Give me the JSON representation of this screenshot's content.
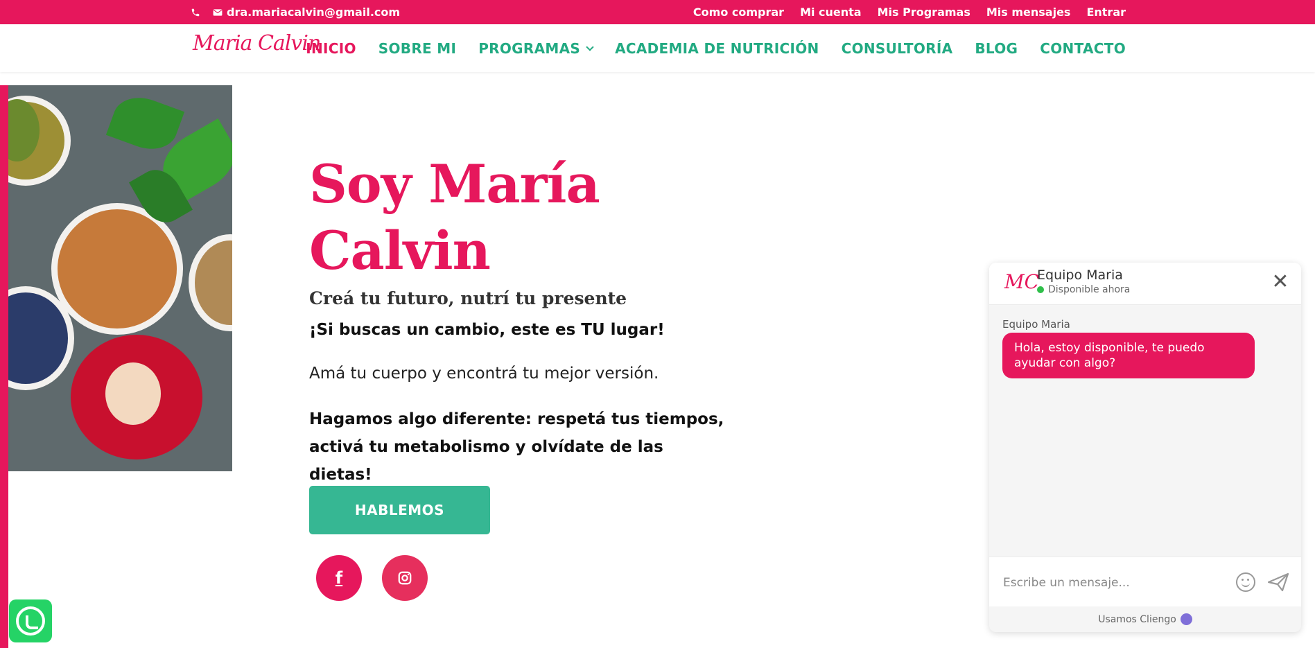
{
  "topbar": {
    "phone_icon": "phone-icon",
    "email": "dra.mariacalvin@gmail.com",
    "links": [
      "Como comprar",
      "Mi cuenta",
      "Mis Programas",
      "Mis mensajes",
      "Entrar"
    ]
  },
  "header": {
    "logo": "Maria Calvin",
    "nav": [
      "INICIO",
      "SOBRE MI",
      "PROGRAMAS",
      "ACADEMIA DE NUTRICIÓN",
      "CONSULTORÍA",
      "BLOG",
      "CONTACTO"
    ]
  },
  "hero": {
    "title_line1": "Soy María",
    "title_line2": "Calvin",
    "subtitle": "Creá tu futuro, nutrí tu presente",
    "line1": "¡Si buscas un cambio, este es TU lugar!",
    "line2": "Amá tu cuerpo y encontrá tu mejor versión.",
    "line3": "Hagamos algo diferente: respetá tus tiempos, activá tu metabolismo y olvídate de las dietas!",
    "cta": "HABLEMOS",
    "social_fb": "f",
    "social_ig": "instagram-icon"
  },
  "chat": {
    "avatar": "MC",
    "name": "Equipo Maria",
    "status": "Disponible ahora",
    "close": "✕",
    "author": "Equipo Maria",
    "message": "Hola, estoy disponible, te puedo ayudar con algo?",
    "input_placeholder": "Escribe un mensaje...",
    "footer": "Usamos Cliengo"
  },
  "colors": {
    "brand_pink": "#e6175c",
    "brand_green": "#22aa82",
    "button_green": "#36b793",
    "whatsapp": "#25d366"
  }
}
